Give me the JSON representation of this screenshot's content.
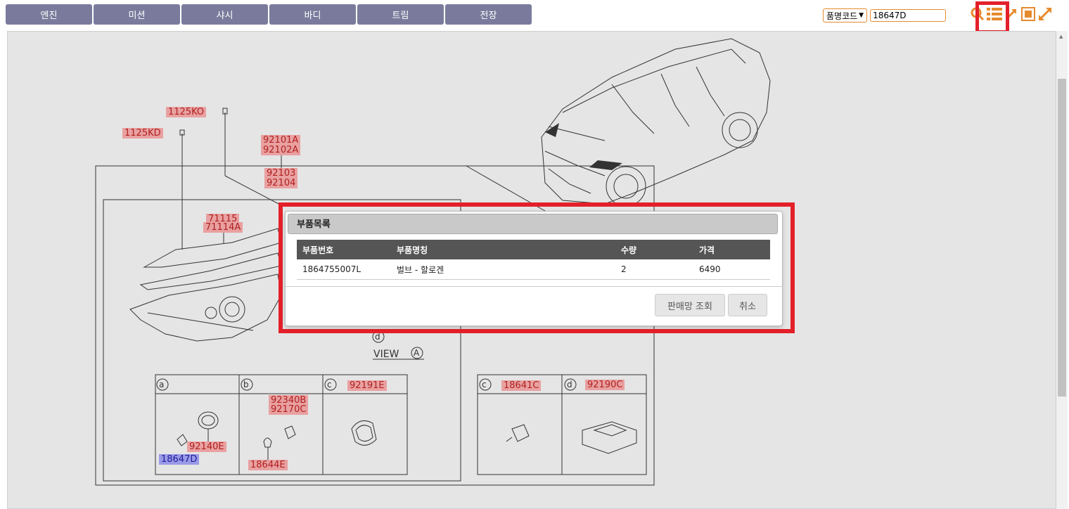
{
  "tabs": [
    "엔진",
    "미션",
    "샤시",
    "바디",
    "트림",
    "전장"
  ],
  "search": {
    "type_selected": "품명코드",
    "value": "18647D"
  },
  "diagram": {
    "labels": [
      "1125KO",
      "1125KD",
      "92101A",
      "92102A",
      "92103",
      "92104",
      "71115",
      "71114A",
      "92191E",
      "92340B",
      "92170C",
      "92140E",
      "18647D",
      "18644E",
      "18641C",
      "92190C"
    ],
    "callouts": [
      "a",
      "b",
      "c",
      "c",
      "d",
      "d"
    ],
    "view_text": "VIEW",
    "view_letter": "A"
  },
  "dialog": {
    "title": "부품목록",
    "columns": [
      "부품번호",
      "부품명칭",
      "수량",
      "가격"
    ],
    "rows": [
      [
        "1864755007L",
        "벌브 - 할로겐",
        "2",
        "6490"
      ]
    ],
    "buttons": {
      "dealer": "판매망 조회",
      "cancel": "취소"
    }
  },
  "colors": {
    "tab_bg": "#7a7b9c",
    "accent_orange": "#e68a2e",
    "highlight_red": "#e3202a",
    "label_pink": "#e9a0a0",
    "label_blue": "#9a9ae6"
  },
  "icons": [
    "search-icon",
    "list-icon",
    "collapse-icon",
    "frame-icon",
    "expand-icon"
  ]
}
